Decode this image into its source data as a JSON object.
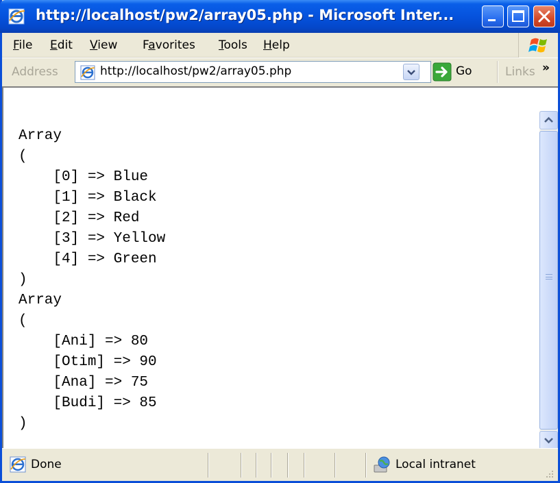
{
  "window": {
    "title": "http://localhost/pw2/array05.php - Microsoft Inter...",
    "title_bar_color": "#0552dd",
    "close_button_color": "#d44a2a"
  },
  "menu": {
    "items": [
      {
        "label": "File",
        "accel": "F"
      },
      {
        "label": "Edit",
        "accel": "E"
      },
      {
        "label": "View",
        "accel": "V"
      },
      {
        "label": "Favorites",
        "accel": "a"
      },
      {
        "label": "Tools",
        "accel": "T"
      },
      {
        "label": "Help",
        "accel": "H"
      }
    ],
    "logo_icon": "windows-flag-icon"
  },
  "address": {
    "label": "Address",
    "url": "http://localhost/pw2/array05.php",
    "go_label": "Go",
    "links_label": "Links",
    "links_chevron": "»",
    "page_icon": "ie-page-icon",
    "go_icon": "green-arrow-icon"
  },
  "page": {
    "lines": [
      "Array",
      "(",
      "    [0] => Blue",
      "    [1] => Black",
      "    [2] => Red",
      "    [3] => Yellow",
      "    [4] => Green",
      ")",
      "Array",
      "(",
      "    [Ani] => 80",
      "    [Otim] => 90",
      "    [Ana] => 75",
      "    [Budi] => 85",
      ")"
    ]
  },
  "status": {
    "text": "Done",
    "zone": "Local intranet",
    "status_icon": "ie-page-icon",
    "zone_icon": "intranet-globe-icon"
  }
}
